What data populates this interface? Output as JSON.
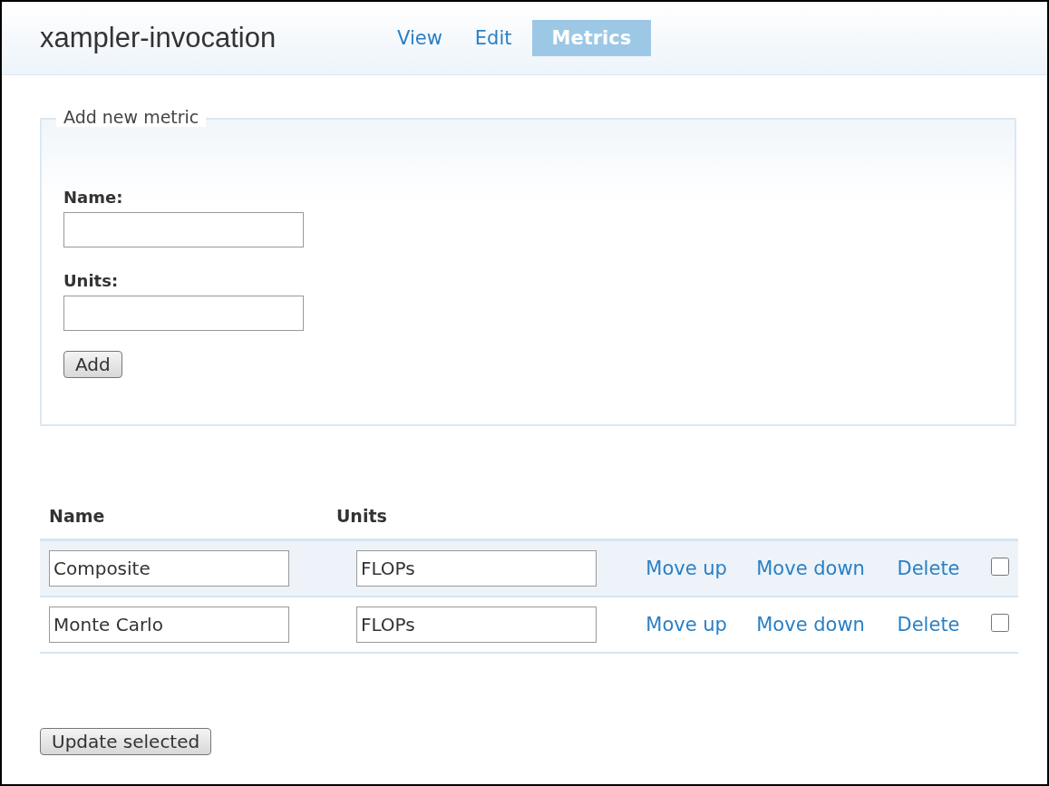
{
  "header": {
    "title": "xampler-invocation"
  },
  "tabs": [
    {
      "label": "View",
      "selected": false
    },
    {
      "label": "Edit",
      "selected": false
    },
    {
      "label": "Metrics",
      "selected": true
    }
  ],
  "form": {
    "legend": "Add new metric",
    "fields": [
      {
        "label": "Name:"
      },
      {
        "label": "Units:"
      }
    ],
    "button": "Add"
  },
  "table": {
    "columns": [
      "Name",
      "Units"
    ],
    "rows": [
      {
        "name": "Composite",
        "units": "FLOPs",
        "actions": [
          "Move up",
          "Move down",
          "Delete"
        ],
        "checked": false
      },
      {
        "name": "Monte Carlo",
        "units": "FLOPs",
        "actions": [
          "Move up",
          "Move down",
          "Delete"
        ],
        "checked": false
      }
    ]
  },
  "footer_button": "Update selected"
}
